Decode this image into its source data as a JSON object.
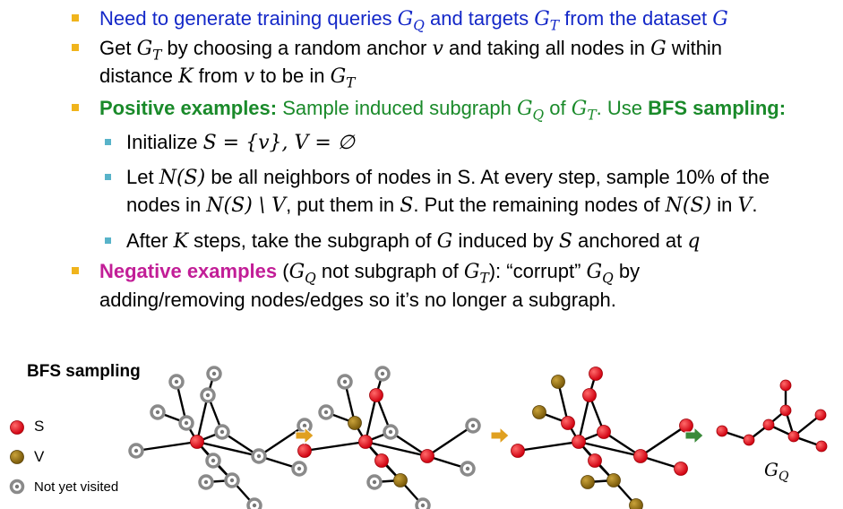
{
  "bullets": {
    "b1": {
      "text_a": "Need to generate training queries ",
      "text_b": " and targets ",
      "text_c": " from the dataset "
    },
    "b2": {
      "text_a": "Get ",
      "text_b": " by choosing a random anchor ",
      "text_c": " and taking all nodes in ",
      "text_d": " within",
      "text_e": "distance ",
      "text_f": " from ",
      "text_g": " to be in "
    },
    "b3": {
      "label": "Positive examples:",
      "text_a": " Sample induced subgraph ",
      "text_b": " of ",
      "text_c": ". Use ",
      "bfs": "BFS sampling:"
    },
    "s1": {
      "text_a": "Initialize ",
      "math": "S = {v},  V = ∅"
    },
    "s2": {
      "text_a": "Let ",
      "text_b": " be all neighbors of nodes in S. At every step, sample 10% of the",
      "text_c": "nodes in ",
      "text_d": ", put them in ",
      "text_e": ". Put the remaining nodes of ",
      "text_f": " in "
    },
    "s3": {
      "text_a": "After ",
      "text_b": " steps, take the subgraph of ",
      "text_c": " induced by ",
      "text_d": " anchored at "
    },
    "b4": {
      "label": "Negative examples",
      "text_a": " (",
      "text_b": " not subgraph of ",
      "text_c": "): “corrupt” ",
      "text_d": " by",
      "text_e": "adding/removing nodes/edges so it’s no longer a subgraph."
    }
  },
  "math": {
    "G": "G",
    "GQ_base": "G",
    "GQ_sub": "Q",
    "GT_base": "G",
    "GT_sub": "T",
    "v": "v",
    "K": "K",
    "S": "S",
    "V": "V",
    "q": "q",
    "NS": "N(S)",
    "NS_minus_V": "N(S) \\ V",
    "period": "."
  },
  "figure": {
    "title": "BFS sampling",
    "legend": [
      {
        "label": "S",
        "color": "#e0101a"
      },
      {
        "label": "V",
        "color": "#9a7414"
      },
      {
        "label": "Not yet visited",
        "color": "#8a8a8a"
      }
    ],
    "gq_label_base": "G",
    "gq_label_sub": "Q",
    "colors": {
      "s": "#e0101a",
      "v": "#9a7414",
      "unvisited": "#8a8a8a",
      "arrow_yellow": "#e0a020",
      "arrow_green": "#3a8a3a"
    }
  }
}
